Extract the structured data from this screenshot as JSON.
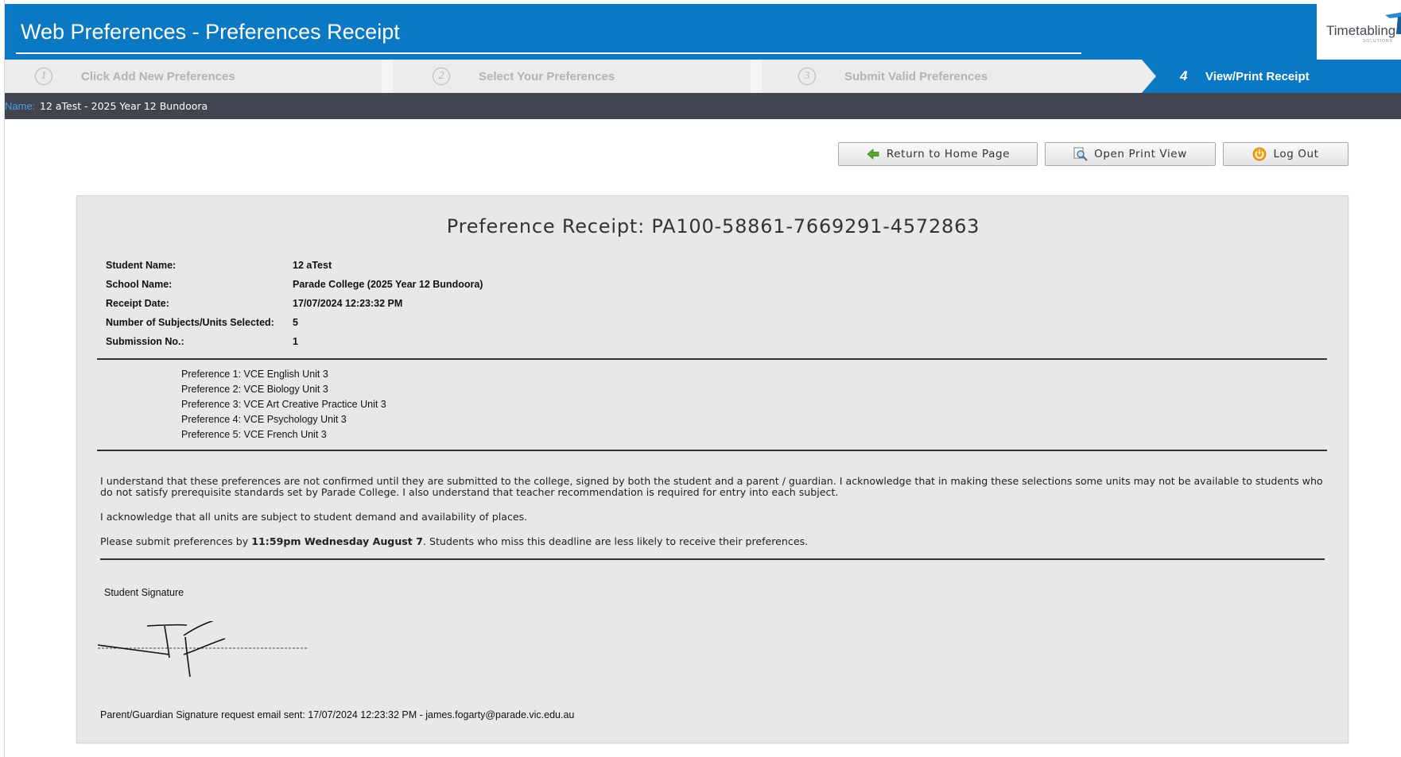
{
  "header": {
    "title": "Web Preferences - Preferences Receipt",
    "logo_text": "Timetabling",
    "logo_sub": "SOLUTIONS",
    "color": "#0a78c2"
  },
  "steps": [
    {
      "num": "1",
      "label": "Click Add New Preferences",
      "active": false
    },
    {
      "num": "2",
      "label": "Select Your Preferences",
      "active": false
    },
    {
      "num": "3",
      "label": "Submit Valid Preferences",
      "active": false
    },
    {
      "num": "4",
      "label": "View/Print Receipt",
      "active": true
    }
  ],
  "namebar": {
    "label": "Name:",
    "value": "12 aTest - 2025 Year 12 Bundoora"
  },
  "buttons": {
    "home": {
      "label": "Return to Home Page",
      "icon": "arrow-left-icon"
    },
    "print": {
      "label": "Open Print View",
      "icon": "magnifier-icon"
    },
    "logout": {
      "label": "Log Out",
      "icon": "power-icon"
    }
  },
  "receipt": {
    "title": "Preference Receipt: PA100-58861-7669291-4572863",
    "fields": [
      {
        "label": "Student Name:",
        "value": "12 aTest"
      },
      {
        "label": "School Name:",
        "value": "Parade College (2025 Year 12 Bundoora)"
      },
      {
        "label": "Receipt Date:",
        "value": "17/07/2024 12:23:32 PM"
      },
      {
        "label": "Number of Subjects/Units Selected:",
        "value": "5"
      },
      {
        "label": "Submission No.:",
        "value": "1"
      }
    ],
    "preferences": [
      "Preference 1: VCE English Unit 3",
      "Preference 2: VCE Biology Unit 3",
      "Preference 3: VCE Art Creative Practice Unit 3",
      "Preference 4: VCE Psychology Unit 3",
      "Preference 5: VCE French Unit 3"
    ],
    "declaration_1": "I understand that these preferences are not confirmed until they are submitted to the college, signed by both the student and a parent / guardian.  I acknowledge that in making these selections some units may not be available to students who do not satisfy prerequisite standards set by Parade College. I also understand that teacher recommendation is required for entry into each subject.",
    "declaration_2": "I acknowledge that all units are subject to student demand and availability of places.",
    "deadline_prefix": "Please submit preferences by ",
    "deadline_bold": "11:59pm Wednesday August 7",
    "deadline_suffix": ". Students who miss this deadline are less likely to receive their preferences.",
    "signature_label": "Student Signature",
    "email_line": "Parent/Guardian Signature request email sent: 17/07/2024 12:23:32 PM - james.fogarty@parade.vic.edu.au"
  }
}
